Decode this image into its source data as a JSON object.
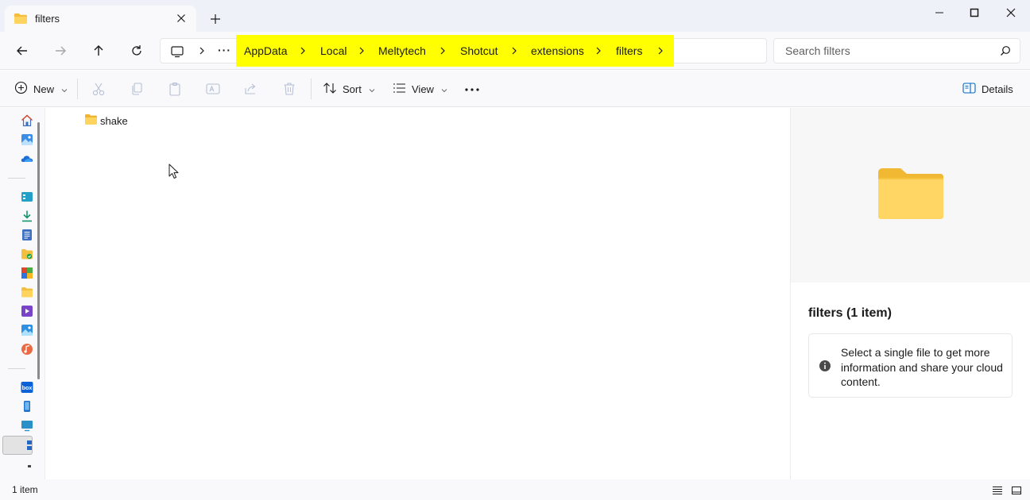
{
  "window": {
    "tab_title": "filters",
    "tab_icon": "folder-icon",
    "controls": [
      "minimize-icon",
      "maximize-icon",
      "close-icon"
    ]
  },
  "navigation": {
    "buttons": [
      "back-arrow-icon",
      "forward-arrow-icon",
      "up-arrow-icon",
      "refresh-icon"
    ],
    "breadcrumb": [
      "AppData",
      "Local",
      "Meltytech",
      "Shotcut",
      "extensions",
      "filters"
    ],
    "breadcrumb_highlight": "#ffff00",
    "more_label": "···",
    "search_placeholder": "Search filters"
  },
  "commands": {
    "new_label": "New",
    "sort_label": "Sort",
    "view_label": "View",
    "details_label": "Details",
    "disabled_icons": [
      "cut-icon",
      "copy-icon",
      "paste-icon",
      "rename-icon",
      "share-icon",
      "delete-icon"
    ]
  },
  "sidebar": {
    "icons": [
      "home-icon",
      "gallery-icon",
      "onedrive-icon",
      "desktop-icon",
      "downloads-icon",
      "documents-icon",
      "folder-icon",
      "app-icon",
      "folder-icon",
      "videos-icon",
      "pictures-icon",
      "music-icon",
      "box-icon",
      "phone-icon",
      "this-pc-icon",
      "network-icon"
    ]
  },
  "files": [
    {
      "name": "shake",
      "type": "folder"
    }
  ],
  "details_pane": {
    "title": "filters (1 item)",
    "info_text": "Select a single file to get more information and share your cloud content."
  },
  "status": {
    "item_count": "1 item"
  },
  "colors": {
    "accent": "#0067c0",
    "folder": "#f8c84a"
  }
}
